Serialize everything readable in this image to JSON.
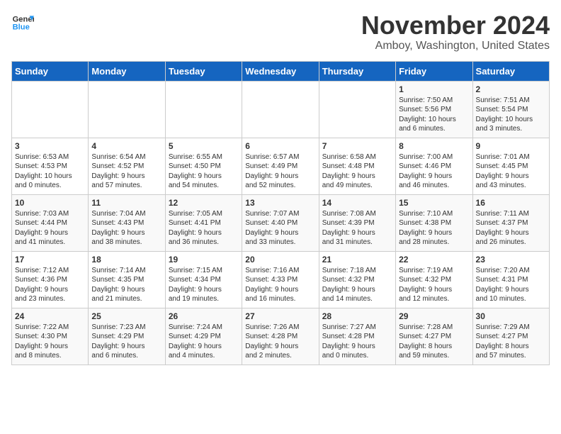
{
  "header": {
    "logo_line1": "General",
    "logo_line2": "Blue",
    "month": "November 2024",
    "location": "Amboy, Washington, United States"
  },
  "weekdays": [
    "Sunday",
    "Monday",
    "Tuesday",
    "Wednesday",
    "Thursday",
    "Friday",
    "Saturday"
  ],
  "weeks": [
    [
      {
        "day": "",
        "info": ""
      },
      {
        "day": "",
        "info": ""
      },
      {
        "day": "",
        "info": ""
      },
      {
        "day": "",
        "info": ""
      },
      {
        "day": "",
        "info": ""
      },
      {
        "day": "1",
        "info": "Sunrise: 7:50 AM\nSunset: 5:56 PM\nDaylight: 10 hours\nand 6 minutes."
      },
      {
        "day": "2",
        "info": "Sunrise: 7:51 AM\nSunset: 5:54 PM\nDaylight: 10 hours\nand 3 minutes."
      }
    ],
    [
      {
        "day": "3",
        "info": "Sunrise: 6:53 AM\nSunset: 4:53 PM\nDaylight: 10 hours\nand 0 minutes."
      },
      {
        "day": "4",
        "info": "Sunrise: 6:54 AM\nSunset: 4:52 PM\nDaylight: 9 hours\nand 57 minutes."
      },
      {
        "day": "5",
        "info": "Sunrise: 6:55 AM\nSunset: 4:50 PM\nDaylight: 9 hours\nand 54 minutes."
      },
      {
        "day": "6",
        "info": "Sunrise: 6:57 AM\nSunset: 4:49 PM\nDaylight: 9 hours\nand 52 minutes."
      },
      {
        "day": "7",
        "info": "Sunrise: 6:58 AM\nSunset: 4:48 PM\nDaylight: 9 hours\nand 49 minutes."
      },
      {
        "day": "8",
        "info": "Sunrise: 7:00 AM\nSunset: 4:46 PM\nDaylight: 9 hours\nand 46 minutes."
      },
      {
        "day": "9",
        "info": "Sunrise: 7:01 AM\nSunset: 4:45 PM\nDaylight: 9 hours\nand 43 minutes."
      }
    ],
    [
      {
        "day": "10",
        "info": "Sunrise: 7:03 AM\nSunset: 4:44 PM\nDaylight: 9 hours\nand 41 minutes."
      },
      {
        "day": "11",
        "info": "Sunrise: 7:04 AM\nSunset: 4:43 PM\nDaylight: 9 hours\nand 38 minutes."
      },
      {
        "day": "12",
        "info": "Sunrise: 7:05 AM\nSunset: 4:41 PM\nDaylight: 9 hours\nand 36 minutes."
      },
      {
        "day": "13",
        "info": "Sunrise: 7:07 AM\nSunset: 4:40 PM\nDaylight: 9 hours\nand 33 minutes."
      },
      {
        "day": "14",
        "info": "Sunrise: 7:08 AM\nSunset: 4:39 PM\nDaylight: 9 hours\nand 31 minutes."
      },
      {
        "day": "15",
        "info": "Sunrise: 7:10 AM\nSunset: 4:38 PM\nDaylight: 9 hours\nand 28 minutes."
      },
      {
        "day": "16",
        "info": "Sunrise: 7:11 AM\nSunset: 4:37 PM\nDaylight: 9 hours\nand 26 minutes."
      }
    ],
    [
      {
        "day": "17",
        "info": "Sunrise: 7:12 AM\nSunset: 4:36 PM\nDaylight: 9 hours\nand 23 minutes."
      },
      {
        "day": "18",
        "info": "Sunrise: 7:14 AM\nSunset: 4:35 PM\nDaylight: 9 hours\nand 21 minutes."
      },
      {
        "day": "19",
        "info": "Sunrise: 7:15 AM\nSunset: 4:34 PM\nDaylight: 9 hours\nand 19 minutes."
      },
      {
        "day": "20",
        "info": "Sunrise: 7:16 AM\nSunset: 4:33 PM\nDaylight: 9 hours\nand 16 minutes."
      },
      {
        "day": "21",
        "info": "Sunrise: 7:18 AM\nSunset: 4:32 PM\nDaylight: 9 hours\nand 14 minutes."
      },
      {
        "day": "22",
        "info": "Sunrise: 7:19 AM\nSunset: 4:32 PM\nDaylight: 9 hours\nand 12 minutes."
      },
      {
        "day": "23",
        "info": "Sunrise: 7:20 AM\nSunset: 4:31 PM\nDaylight: 9 hours\nand 10 minutes."
      }
    ],
    [
      {
        "day": "24",
        "info": "Sunrise: 7:22 AM\nSunset: 4:30 PM\nDaylight: 9 hours\nand 8 minutes."
      },
      {
        "day": "25",
        "info": "Sunrise: 7:23 AM\nSunset: 4:29 PM\nDaylight: 9 hours\nand 6 minutes."
      },
      {
        "day": "26",
        "info": "Sunrise: 7:24 AM\nSunset: 4:29 PM\nDaylight: 9 hours\nand 4 minutes."
      },
      {
        "day": "27",
        "info": "Sunrise: 7:26 AM\nSunset: 4:28 PM\nDaylight: 9 hours\nand 2 minutes."
      },
      {
        "day": "28",
        "info": "Sunrise: 7:27 AM\nSunset: 4:28 PM\nDaylight: 9 hours\nand 0 minutes."
      },
      {
        "day": "29",
        "info": "Sunrise: 7:28 AM\nSunset: 4:27 PM\nDaylight: 8 hours\nand 59 minutes."
      },
      {
        "day": "30",
        "info": "Sunrise: 7:29 AM\nSunset: 4:27 PM\nDaylight: 8 hours\nand 57 minutes."
      }
    ]
  ]
}
